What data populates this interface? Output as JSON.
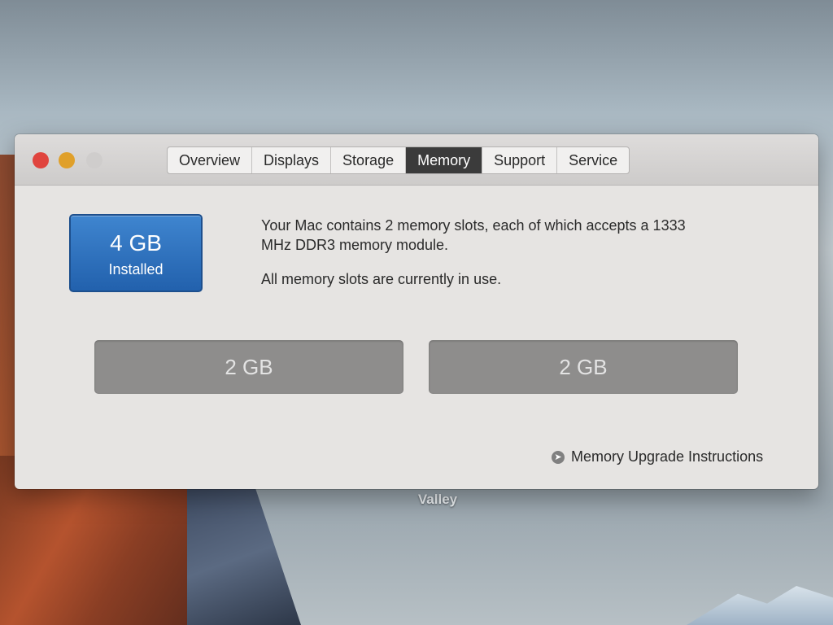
{
  "desktop": {
    "label": "Valley"
  },
  "window": {
    "tabs": [
      {
        "label": "Overview"
      },
      {
        "label": "Displays"
      },
      {
        "label": "Storage"
      },
      {
        "label": "Memory"
      },
      {
        "label": "Support"
      },
      {
        "label": "Service"
      }
    ],
    "active_tab": "Memory"
  },
  "memory": {
    "installed_size": "4 GB",
    "installed_label": "Installed",
    "description_line1": "Your Mac contains 2 memory slots, each of which accepts a 1333 MHz DDR3 memory module.",
    "description_line2": "All memory slots are currently in use.",
    "slots": [
      {
        "size": "2 GB"
      },
      {
        "size": "2 GB"
      }
    ],
    "upgrade_link": "Memory Upgrade Instructions"
  },
  "colors": {
    "installed_box": "#2f74c0",
    "active_tab": "#3b3b3b",
    "close": "#e0443e",
    "minimize": "#e0a02a"
  }
}
